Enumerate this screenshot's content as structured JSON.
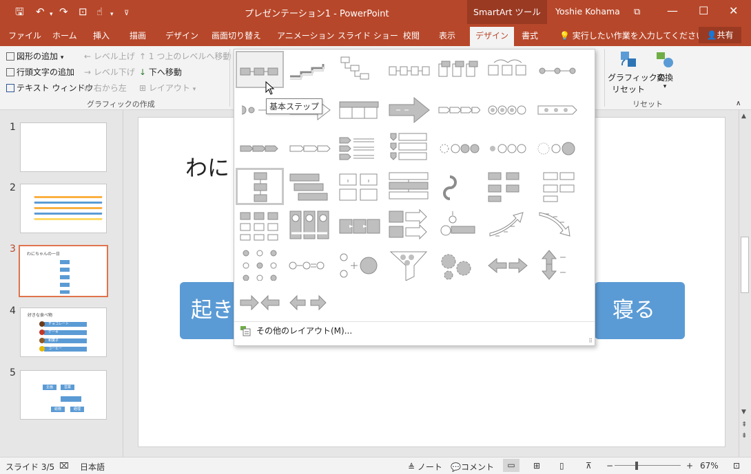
{
  "window": {
    "title": "プレゼンテーション1 - PowerPoint",
    "context_tab": "SmartArt ツール",
    "user": "Yoshie Kohama"
  },
  "tabs": [
    "ファイル",
    "ホーム",
    "挿入",
    "描画",
    "デザイン",
    "画面切り替え",
    "アニメーション",
    "スライド ショー",
    "校閲",
    "表示",
    "デザイン",
    "書式"
  ],
  "tell_me": "実行したい作業を入力してください",
  "share": "共有",
  "ribbon": {
    "add_shape": "図形の追加",
    "add_bullet": "行頭文字の追加",
    "text_pane": "テキスト ウィンドウ",
    "promote": "レベル上げ",
    "demote": "レベル下げ",
    "right_to_left": "右から左",
    "move_up": "1 つ上のレベルへ移動",
    "move_down": "下へ移動",
    "layout": "レイアウト",
    "group_create": "グラフィックの作成",
    "reset_graphic_1": "グラフィックの",
    "reset_graphic_2": "リセット",
    "convert": "変換",
    "group_reset": "リセット"
  },
  "thumbnails": {
    "numbers": [
      "1",
      "2",
      "3",
      "4",
      "5"
    ],
    "s3_title": "わにちゃんの一日",
    "s4_title": "好きな食べ物",
    "s4_items": [
      "チョコレート",
      "ケーキ",
      "和菓子",
      "コーヒー"
    ],
    "s5_items": [
      "企画",
      "営業",
      "総務",
      "経理"
    ]
  },
  "slide": {
    "title_partial": "わに",
    "box_left": "起き",
    "box_right": "寝る"
  },
  "gallery": {
    "tooltip": "基本ステップ",
    "more_layouts": "その他のレイアウト(M)..."
  },
  "status": {
    "slide": "スライド 3/5",
    "lang": "日本語",
    "notes": "ノート",
    "comments": "コメント",
    "zoom": "67%"
  }
}
